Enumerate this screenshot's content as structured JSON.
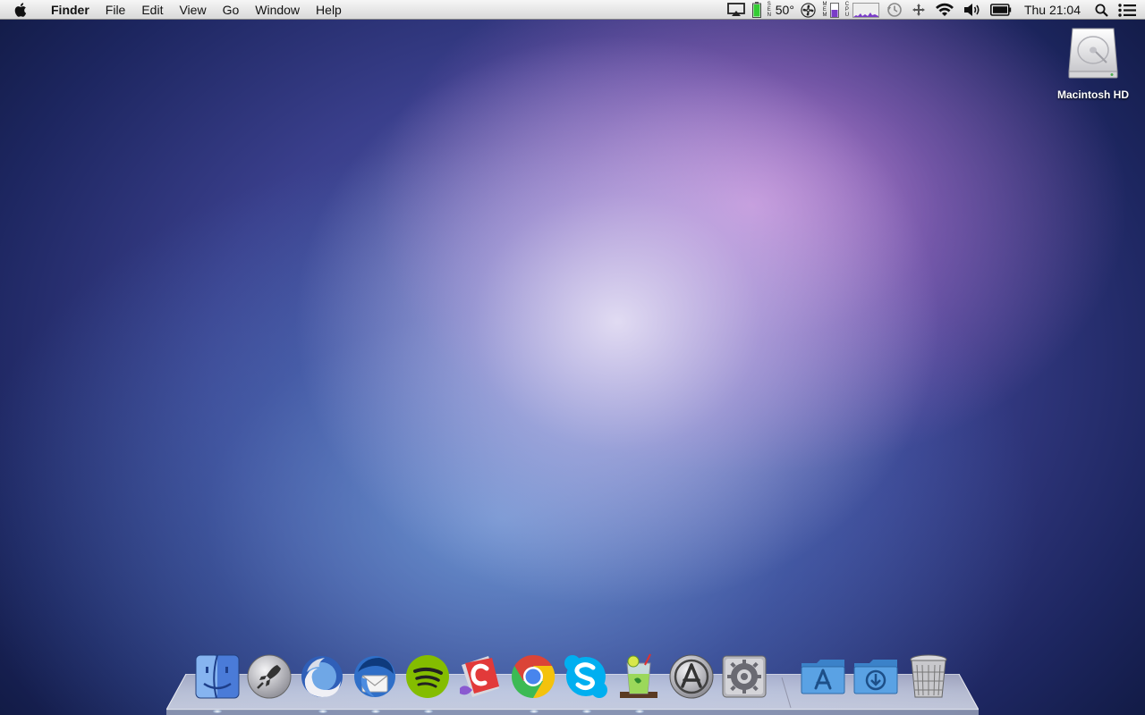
{
  "menubar": {
    "apple_icon": "apple-logo-icon",
    "app_name": "Finder",
    "items": [
      "File",
      "Edit",
      "View",
      "Go",
      "Window",
      "Help"
    ],
    "status": {
      "temperature": "50°",
      "sensor_label": "SEN",
      "mem_label": "MEM",
      "cpu_label": "CPU",
      "clock": "Thu 21:04"
    }
  },
  "desktop": {
    "drive_label": "Macintosh HD"
  },
  "dock": {
    "apps": [
      {
        "name": "Finder",
        "icon": "finder-icon"
      },
      {
        "name": "Launchpad",
        "icon": "rocket-icon"
      },
      {
        "name": "Firefox",
        "icon": "firefox-icon"
      },
      {
        "name": "Thunderbird",
        "icon": "thunderbird-icon"
      },
      {
        "name": "Spotify",
        "icon": "spotify-icon"
      },
      {
        "name": "CloudApp",
        "icon": "cloudapp-icon"
      },
      {
        "name": "Chrome",
        "icon": "chrome-icon"
      },
      {
        "name": "Skype",
        "icon": "skype-icon"
      },
      {
        "name": "Mojito",
        "icon": "cocktail-glass-icon"
      },
      {
        "name": "App Store",
        "icon": "app-store-icon"
      },
      {
        "name": "System Preferences",
        "icon": "gear-icon"
      }
    ],
    "stacks": [
      {
        "name": "Applications",
        "icon": "applications-folder-icon"
      },
      {
        "name": "Downloads",
        "icon": "downloads-folder-icon"
      },
      {
        "name": "Trash",
        "icon": "trash-icon"
      }
    ]
  },
  "colors": {
    "menubar_top": "#f6f6f6",
    "menubar_bottom": "#d9d9d9",
    "spotify_green": "#84bd00",
    "skype_blue": "#00aff0",
    "battery_green": "#33cc33",
    "mem_purple": "#7a3cc8"
  }
}
